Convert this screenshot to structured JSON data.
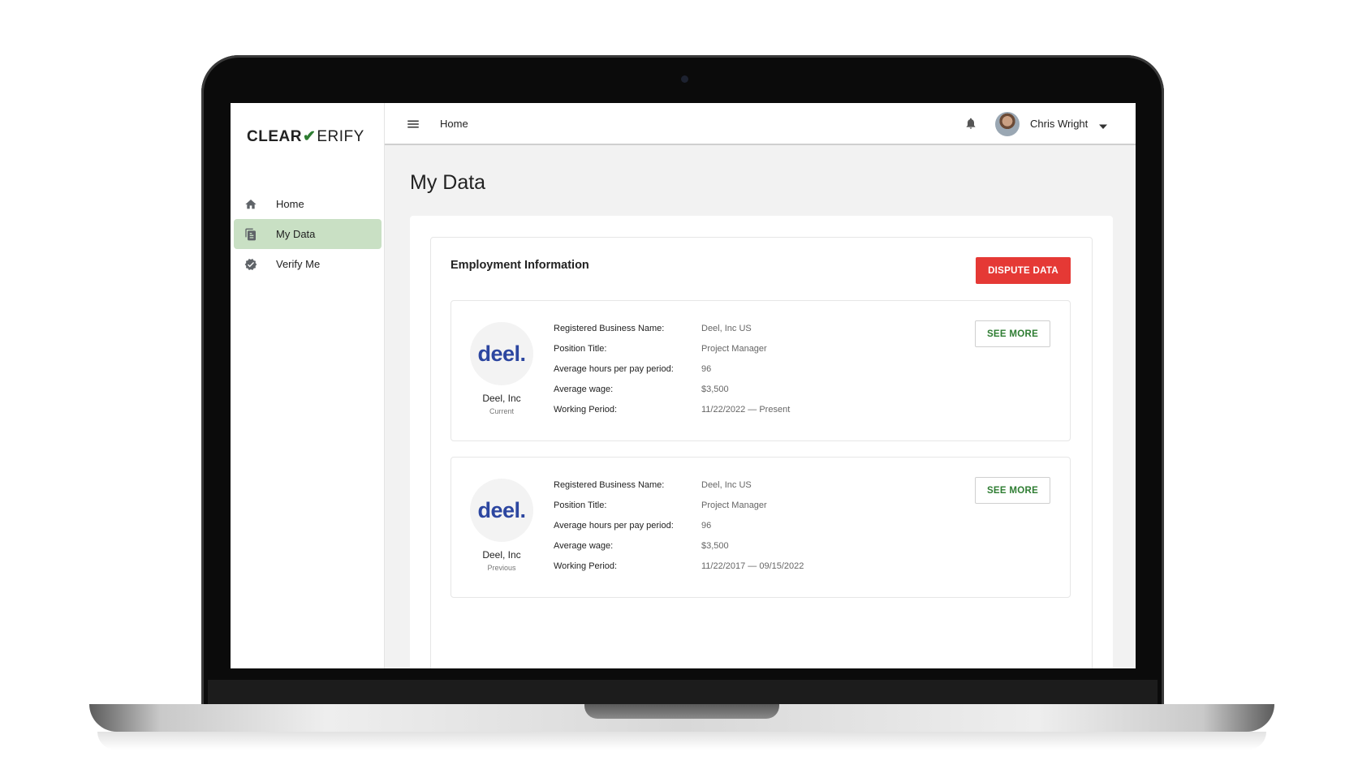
{
  "app": {
    "logo_a": "CLEAR",
    "logo_b": "ERIFY"
  },
  "sidebar": {
    "items": [
      {
        "label": "Home",
        "icon": "home-icon",
        "active": false
      },
      {
        "label": "My Data",
        "icon": "document-icon",
        "active": true
      },
      {
        "label": "Verify Me",
        "icon": "verified-badge-icon",
        "active": false
      }
    ]
  },
  "topbar": {
    "breadcrumb": "Home",
    "user_name": "Chris Wright"
  },
  "page": {
    "title": "My Data"
  },
  "employment": {
    "title": "Employment Information",
    "dispute_label": "DISPUTE DATA",
    "see_more_label": "SEE MORE",
    "field_labels": {
      "business": "Registered Business Name:",
      "position": "Position Title:",
      "hours": "Average hours per pay period:",
      "wage": "Average wage:",
      "period": "Working Period:"
    },
    "jobs": [
      {
        "logo_text": "deel.",
        "company": "Deel, Inc",
        "status": "Current",
        "business": "Deel, Inc US",
        "position": "Project Manager",
        "hours": "96",
        "wage": "$3,500",
        "period": "11/22/2022 — Present"
      },
      {
        "logo_text": "deel.",
        "company": "Deel, Inc",
        "status": "Previous",
        "business": "Deel, Inc US",
        "position": "Project Manager",
        "hours": "96",
        "wage": "$3,500",
        "period": "11/22/2017 — 09/15/2022"
      }
    ]
  },
  "colors": {
    "accent_green": "#2e7d32",
    "active_nav": "#c9e0c4",
    "dispute_red": "#e53935",
    "deel_blue": "#2c46a0"
  }
}
